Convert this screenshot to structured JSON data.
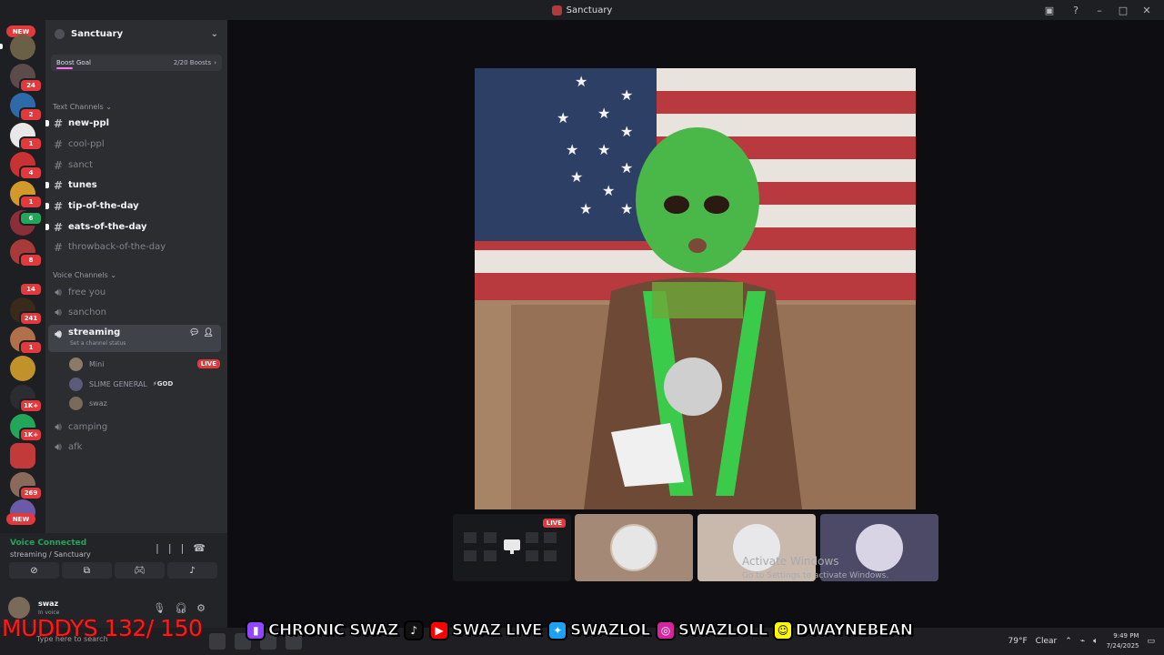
{
  "window": {
    "title": "Sanctuary"
  },
  "rail": {
    "new_label": "NEW",
    "badges": [
      "24",
      "2",
      "1",
      "4",
      "1",
      "6",
      "8",
      "14",
      "241",
      "1",
      "1K+",
      "1K+",
      "269"
    ]
  },
  "server": {
    "name": "Sanctuary",
    "boost_label": "Boost Goal",
    "boost_count": "2/20 Boosts",
    "boost_progress": 0.1
  },
  "channels": {
    "text_category": "Text Channels",
    "text": [
      {
        "name": "new-ppl",
        "unread": true
      },
      {
        "name": "cool-ppl",
        "unread": false
      },
      {
        "name": "sanct",
        "unread": false
      },
      {
        "name": "tunes",
        "unread": true
      },
      {
        "name": "tip-of-the-day",
        "unread": true
      },
      {
        "name": "eats-of-the-day",
        "unread": true
      },
      {
        "name": "throwback-of-the-day",
        "unread": false
      }
    ],
    "voice_category": "Voice Channels",
    "voice": [
      "free you",
      "sanchon",
      "streaming",
      "camping",
      "afk"
    ],
    "streaming_status": "Set a channel status",
    "voice_users": [
      {
        "name": "Mini",
        "live": "LIVE"
      },
      {
        "name": "SLIME GENERAL",
        "tag": "GOD"
      },
      {
        "name": "swaz"
      }
    ]
  },
  "voice_panel": {
    "connected": "Voice Connected",
    "location": "streaming / Sanctuary"
  },
  "user": {
    "name": "swaz",
    "status": "In voice"
  },
  "stream": {
    "live_label": "LIVE"
  },
  "activation": {
    "line1": "Activate Windows",
    "line2": "Go to Settings to activate Windows."
  },
  "overlay": {
    "twitch": "CHRONIC SWAZ",
    "youtube": "SWAZ LIVE",
    "twitter": "SWAZLOL",
    "instagram": "SWAZLOLL",
    "snapchat": "DWAYNEBEAN",
    "muddys": "MUDDYS 132/ 150"
  },
  "taskbar": {
    "search_ghost": "Type here to search",
    "weather": "79°F",
    "weather_desc": "Clear",
    "time": "9:49 PM",
    "date": "7/24/2025"
  },
  "colors": {
    "accent_live": "#e03a3e",
    "voice_green": "#23a55a",
    "muddys_red": "#ff1a1a"
  }
}
